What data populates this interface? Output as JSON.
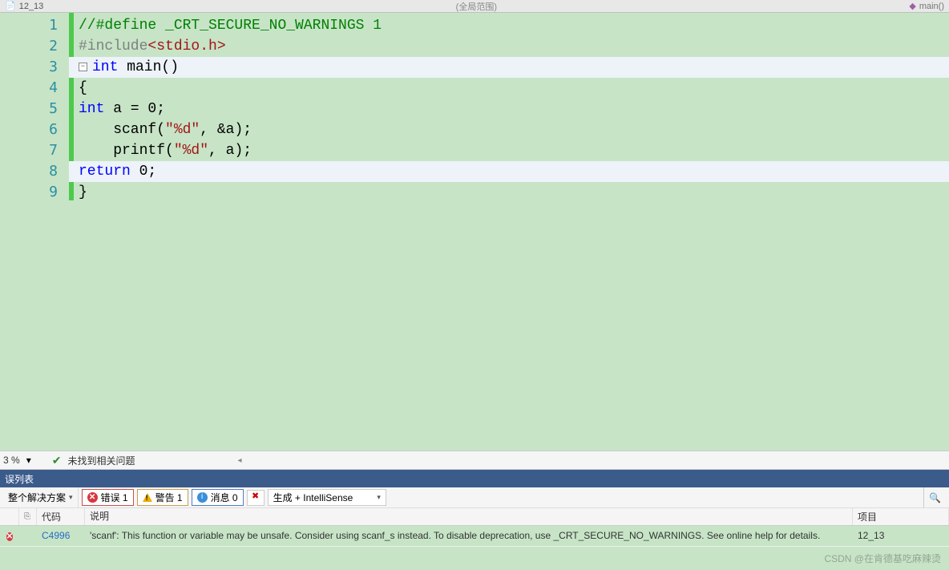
{
  "topbar": {
    "tab_prefix": "12_13",
    "center_hint": "(全局范围)",
    "right_nav": "main()"
  },
  "code": {
    "lines": [
      {
        "n": "1"
      },
      {
        "n": "2"
      },
      {
        "n": "3"
      },
      {
        "n": "4"
      },
      {
        "n": "5"
      },
      {
        "n": "6"
      },
      {
        "n": "7"
      },
      {
        "n": "8"
      },
      {
        "n": "9"
      }
    ],
    "l1_comment": "//#define _CRT_SECURE_NO_WARNINGS 1",
    "l2_pp": "#include",
    "l2_hdr": "<stdio.h>",
    "l3_kw": "int",
    "l3_rest": " main()",
    "l4": "{",
    "l5_kw": "int",
    "l5_rest": " a = 0;",
    "l6_a": "    scanf(",
    "l6_str": "\"%d\"",
    "l6_b": ", &a);",
    "l7_a": "    printf(",
    "l7_str": "\"%d\"",
    "l7_b": ", a);",
    "l8_kw": "return",
    "l8_rest": " 0;",
    "l9": "}"
  },
  "status": {
    "zoom": "3 %",
    "ok_text": "未找到相关问题"
  },
  "error_panel": {
    "title": "误列表",
    "scope": "整个解决方案",
    "err_label": "错误 1",
    "warn_label": "警告 1",
    "info_label": "消息 0",
    "build_source": "生成 + IntelliSense",
    "columns": {
      "code": "代码",
      "desc": "说明",
      "proj": "项目"
    },
    "rows": [
      {
        "code": "C4996",
        "desc": "'scanf': This function or variable may be unsafe. Consider using scanf_s instead. To disable deprecation, use _CRT_SECURE_NO_WARNINGS. See online help for details.",
        "proj": "12_13"
      }
    ]
  },
  "watermark": "CSDN @在肯德基吃麻辣烫"
}
